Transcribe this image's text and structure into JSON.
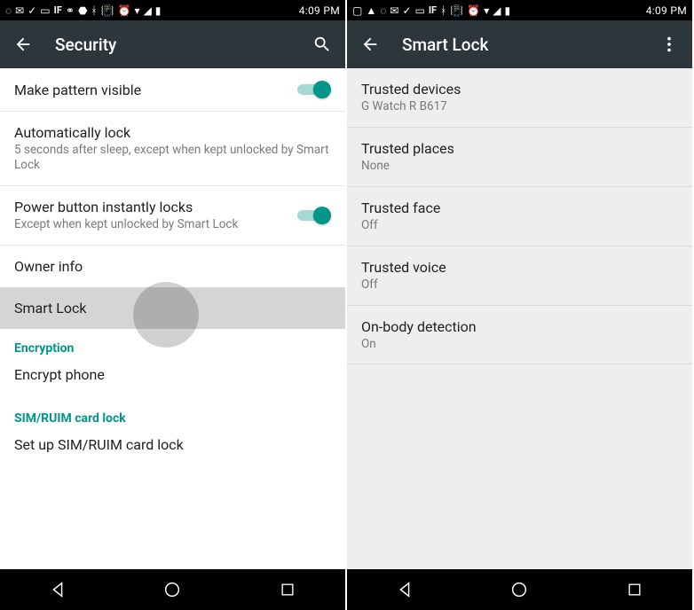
{
  "left": {
    "status": {
      "clock": "4:09 PM"
    },
    "appbar": {
      "title": "Security"
    },
    "items": [
      {
        "title": "Make pattern visible",
        "sub": "",
        "switch": true
      },
      {
        "title": "Automatically lock",
        "sub": "5 seconds after sleep, except when kept unlocked by Smart Lock"
      },
      {
        "title": "Power button instantly locks",
        "sub": "Except when kept unlocked by Smart Lock",
        "switch": true
      },
      {
        "title": "Owner info",
        "sub": ""
      },
      {
        "title": "Smart Lock",
        "sub": "",
        "pressed": true
      }
    ],
    "section1": "Encryption",
    "encrypt": "Encrypt phone",
    "section2": "SIM/RUIM card lock",
    "sim": "Set up SIM/RUIM card lock"
  },
  "right": {
    "status": {
      "clock": "4:09 PM"
    },
    "appbar": {
      "title": "Smart Lock"
    },
    "items": [
      {
        "title": "Trusted devices",
        "sub": "G Watch R B617"
      },
      {
        "title": "Trusted places",
        "sub": "None"
      },
      {
        "title": "Trusted face",
        "sub": "Off"
      },
      {
        "title": "Trusted voice",
        "sub": "Off"
      },
      {
        "title": "On-body detection",
        "sub": "On"
      }
    ]
  }
}
